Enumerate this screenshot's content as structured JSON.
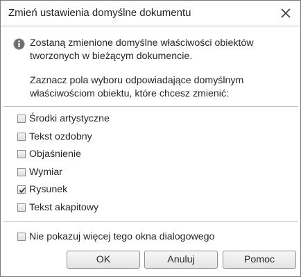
{
  "dialog": {
    "title": "Zmień ustawienia domyślne dokumentu",
    "close_icon": "close-icon"
  },
  "info": {
    "icon": "info-icon",
    "text": "Zostaną zmienione domyślne właściwości obiektów tworzonych w bieżącym dokumencie.",
    "hint": "Zaznacz pola wyboru odpowiadające domyślnym właściwościom obiektu, które chcesz zmienić:"
  },
  "options": [
    {
      "label": "Środki artystyczne",
      "checked": false
    },
    {
      "label": "Tekst ozdobny",
      "checked": false
    },
    {
      "label": "Objaśnienie",
      "checked": false
    },
    {
      "label": "Wymiar",
      "checked": false
    },
    {
      "label": "Rysunek",
      "checked": true
    },
    {
      "label": "Tekst akapitowy",
      "checked": false
    }
  ],
  "dont_show": {
    "label": "Nie pokazuj więcej tego okna dialogowego",
    "checked": false
  },
  "buttons": {
    "ok": "OK",
    "cancel": "Anuluj",
    "help": "Pomoc"
  },
  "colors": {
    "info_icon": "#6b6b6b",
    "border": "#7a7a7a",
    "separator": "#bdbdbd"
  }
}
